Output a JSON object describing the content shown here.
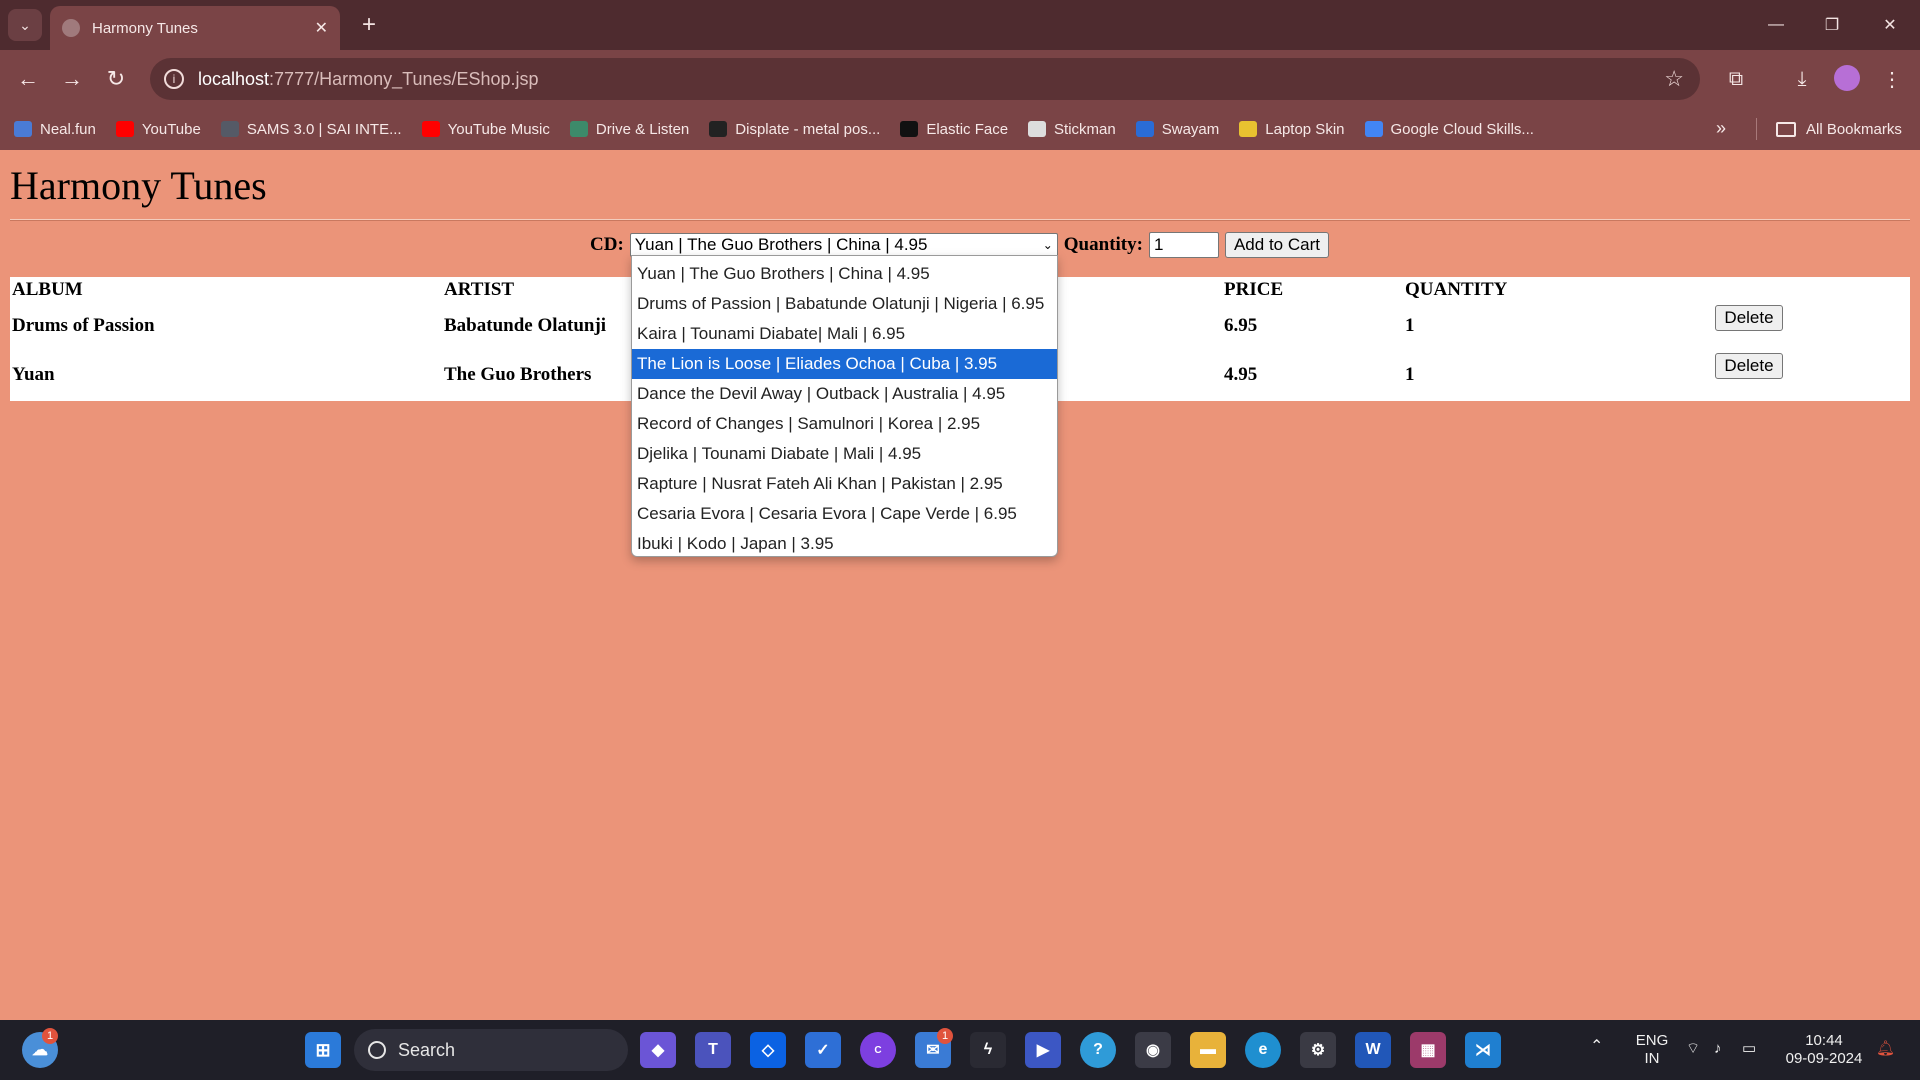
{
  "browser": {
    "tab_title": "Harmony Tunes",
    "tab_close": "✕",
    "new_tab": "+",
    "url_host": "localhost",
    "url_path": ":7777/Harmony_Tunes/EShop.jsp",
    "bookmarks": [
      {
        "label": "Neal.fun",
        "color": "#4a7bd6"
      },
      {
        "label": "YouTube",
        "color": "#ff0000"
      },
      {
        "label": "SAMS 3.0 | SAI INTE...",
        "color": "#555a66"
      },
      {
        "label": "YouTube Music",
        "color": "#ff0000"
      },
      {
        "label": "Drive & Listen",
        "color": "#3d8a6a"
      },
      {
        "label": "Displate - metal pos...",
        "color": "#222222"
      },
      {
        "label": "Elastic Face",
        "color": "#111111"
      },
      {
        "label": "Stickman",
        "color": "#dddddd"
      },
      {
        "label": "Swayam",
        "color": "#2a6cd6"
      },
      {
        "label": "Laptop Skin",
        "color": "#e8c230"
      },
      {
        "label": "Google Cloud Skills...",
        "color": "#4285f4"
      }
    ],
    "all_bookmarks": "All Bookmarks"
  },
  "page": {
    "title": "Harmony Tunes",
    "cd_label": "CD:",
    "cd_selected": "Yuan | The Guo Brothers | China | 4.95",
    "quantity_label": "Quantity:",
    "quantity_value": "1",
    "add_button": "Add to Cart",
    "cart": {
      "headers": [
        "ALBUM",
        "ARTIST",
        "PRICE",
        "QUANTITY"
      ],
      "rows": [
        {
          "album": "Drums of Passion",
          "artist": "Babatunde Olatunji",
          "price": "6.95",
          "quantity": "1"
        },
        {
          "album": "Yuan",
          "artist": "The Guo Brothers",
          "price": "4.95",
          "quantity": "1"
        }
      ],
      "delete_label": "Delete"
    },
    "cd_options": [
      "Yuan | The Guo Brothers | China | 4.95",
      "Drums of Passion | Babatunde Olatunji | Nigeria | 6.95",
      "Kaira | Tounami Diabate| Mali | 6.95",
      "The Lion is Loose | Eliades Ochoa | Cuba | 3.95",
      "Dance the Devil Away | Outback | Australia | 4.95",
      "Record of Changes | Samulnori | Korea | 2.95",
      "Djelika | Tounami Diabate | Mali | 4.95",
      "Rapture | Nusrat Fateh Ali Khan | Pakistan | 2.95",
      "Cesaria Evora | Cesaria Evora | Cape Verde | 6.95",
      "Ibuki | Kodo | Japan | 3.95"
    ],
    "highlighted_option": "The Lion is Loose | Eliades Ochoa | Cuba | 3.95"
  },
  "taskbar": {
    "search_label": "Search",
    "weather_badge": "1",
    "mail_badge": "1",
    "lang_top": "ENG",
    "lang_bottom": "IN",
    "time": "10:44",
    "date": "09-09-2024"
  },
  "colors": {
    "page_background": "#eb9479",
    "selected_option": "#1a6ad6",
    "titlebar": "#4e2b2f",
    "toolbar": "#7a4446"
  }
}
